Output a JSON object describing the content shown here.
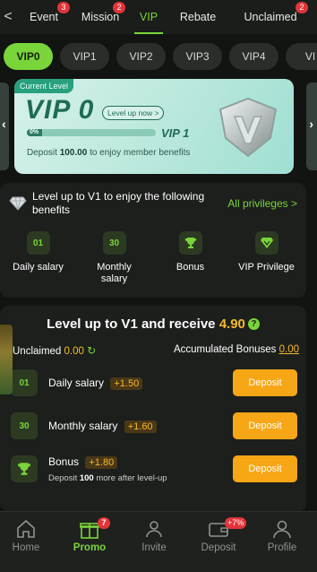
{
  "top_tabs": [
    {
      "label": "Event",
      "badge": "3"
    },
    {
      "label": "Mission",
      "badge": "2"
    },
    {
      "label": "VIP",
      "badge": null
    },
    {
      "label": "Rebate",
      "badge": null
    },
    {
      "label": "Unclaimed",
      "badge": "2"
    }
  ],
  "back_glyph": "<",
  "vip_levels": [
    "VIP0",
    "VIP1",
    "VIP2",
    "VIP3",
    "VIP4",
    "VI"
  ],
  "card": {
    "current_level_label": "Current Level",
    "level": "VIP 0",
    "level_up_link": "Level up now >",
    "progress_text": "0%",
    "progress_fraction": 0.0,
    "next_level": "VIP 1",
    "deposit_prefix": "Deposit",
    "deposit_amount": "100.00",
    "deposit_suffix": "to enjoy member benefits"
  },
  "privileges": {
    "title": "Level up to V1 to enjoy the following benefits",
    "all_link": "All privileges >",
    "items": [
      {
        "icon": "calendar-01-icon",
        "glyph": "01",
        "label": "Daily salary"
      },
      {
        "icon": "calendar-30-icon",
        "glyph": "30",
        "label": "Monthly salary"
      },
      {
        "icon": "trophy-icon",
        "glyph": "",
        "label": "Bonus"
      },
      {
        "icon": "diamond-icon",
        "glyph": "",
        "label": "VIP Privilege"
      }
    ]
  },
  "receive": {
    "title_prefix": "Level up to V1 and receive",
    "title_amount": "4.90",
    "unclaimed_label": "Unclaimed",
    "unclaimed_value": "0.00",
    "accumulated_label": "Accumulated Bonuses",
    "accumulated_value": "0.00",
    "rows": [
      {
        "icon": "calendar-01-icon",
        "glyph": "01",
        "name": "Daily salary",
        "bonus": "+1.50",
        "button": "Deposit"
      },
      {
        "icon": "calendar-30-icon",
        "glyph": "30",
        "name": "Monthly salary",
        "bonus": "+1.60",
        "button": "Deposit"
      },
      {
        "icon": "trophy-icon",
        "glyph": "",
        "name": "Bonus",
        "bonus": "+1.80",
        "button": "Deposit",
        "sub_prefix": "Deposit",
        "sub_amount": "100",
        "sub_suffix": "more after level-up"
      }
    ]
  },
  "bottom_nav": [
    {
      "label": "Home",
      "icon": "home-icon",
      "badge": null
    },
    {
      "label": "Promo",
      "icon": "gift-icon",
      "badge": "7"
    },
    {
      "label": "Invite",
      "icon": "invite-icon",
      "badge": null
    },
    {
      "label": "Deposit",
      "icon": "wallet-icon",
      "badge": "+7%"
    },
    {
      "label": "Profile",
      "icon": "profile-icon",
      "badge": null
    }
  ],
  "colors": {
    "accent_green": "#7ad53a",
    "accent_orange": "#f7a616",
    "amount_yellow": "#f7b92b",
    "badge_red": "#e2343a",
    "background": "#111411",
    "panel": "#1c1f1c"
  }
}
